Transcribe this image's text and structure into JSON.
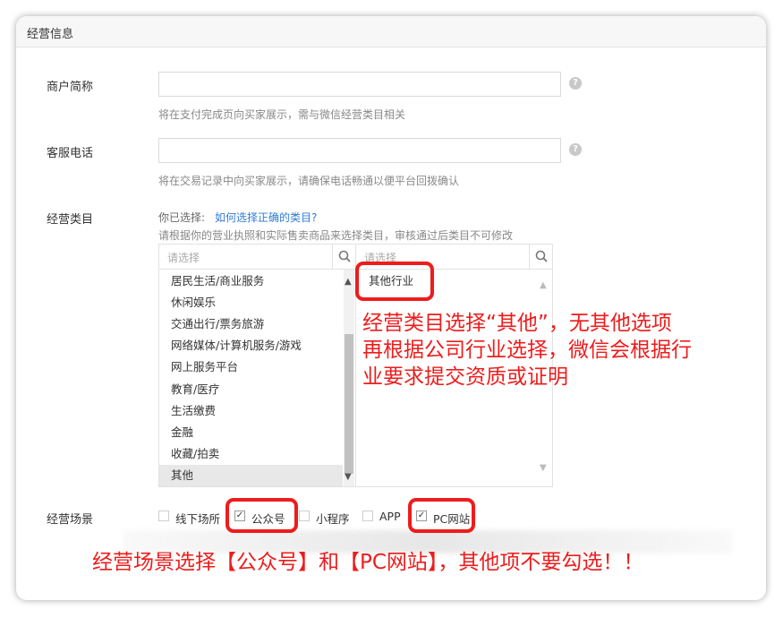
{
  "section_title": "经营信息",
  "fields": {
    "merchant_name": {
      "label": "商户简称",
      "value": "",
      "hint": "将在支付完成页向买家展示，需与微信经营类目相关"
    },
    "service_phone": {
      "label": "客服电话",
      "value": "",
      "hint": "将在交易记录中向买家展示，请确保电话畅通以便平台回拨确认"
    }
  },
  "category": {
    "label": "经营类目",
    "selected_prefix": "你已选择:",
    "help_link": "如何选择正确的类目?",
    "hint": "请根据你的营业执照和实际售卖商品来选择类目，审核通过后类目不可修改",
    "left_placeholder": "请选择",
    "right_placeholder": "请选择",
    "left_items": [
      "居民生活/商业服务",
      "休闲娱乐",
      "交通出行/票务旅游",
      "网络媒体/计算机服务/游戏",
      "网上服务平台",
      "教育/医疗",
      "生活缴费",
      "金融",
      "收藏/拍卖",
      "其他"
    ],
    "left_selected": "其他",
    "right_items": [
      "其他行业"
    ]
  },
  "scene": {
    "label": "经营场景",
    "options": [
      {
        "label": "线下场所",
        "checked": false
      },
      {
        "label": "公众号",
        "checked": true
      },
      {
        "label": "小程序",
        "checked": false
      },
      {
        "label": "APP",
        "checked": false
      },
      {
        "label": "PC网站",
        "checked": true
      }
    ]
  },
  "annotations": {
    "category_note_line1": "经营类目选择“其他”，无其他选项",
    "category_note_line2": "再根据公司行业选择，微信会根据行",
    "category_note_line3": "业要求提交资质或证明",
    "scene_note": "经营场景选择【公众号】和【PC网站】，其他项不要勾选！！"
  },
  "colors": {
    "annotation": "#ee1c1c",
    "link": "#2f7bd6"
  },
  "icons": {
    "help": "question-circle-icon",
    "search": "search-icon",
    "check": "check-icon"
  }
}
